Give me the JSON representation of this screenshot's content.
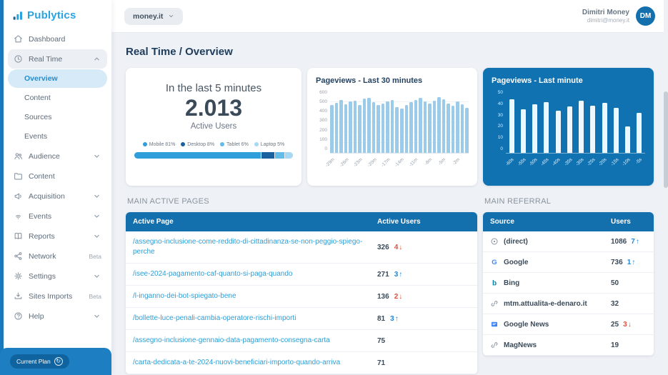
{
  "brand": {
    "name": "Publytics"
  },
  "topbar": {
    "site_selector_label": "money.it",
    "user_name": "Dimitri Money",
    "user_email": "dimitri@money.it",
    "avatar_initials": "DM"
  },
  "sidebar": {
    "items": [
      {
        "label": "Dashboard",
        "icon": "home-icon",
        "trailing": null
      },
      {
        "label": "Real Time",
        "icon": "clock-icon",
        "trailing": "chevron-up",
        "expanded": true,
        "children": [
          {
            "label": "Overview",
            "active": true
          },
          {
            "label": "Content"
          },
          {
            "label": "Sources"
          },
          {
            "label": "Events"
          }
        ]
      },
      {
        "label": "Audience",
        "icon": "users-icon",
        "trailing": "chevron-down"
      },
      {
        "label": "Content",
        "icon": "folder-icon",
        "trailing": null
      },
      {
        "label": "Acquisition",
        "icon": "megaphone-icon",
        "trailing": "chevron-down"
      },
      {
        "label": "Events",
        "icon": "signal-icon",
        "trailing": "chevron-down"
      },
      {
        "label": "Reports",
        "icon": "book-icon",
        "trailing": "chevron-down"
      },
      {
        "label": "Network",
        "icon": "share-icon",
        "trailing": "beta",
        "badge": "Beta"
      },
      {
        "label": "Settings",
        "icon": "gear-icon",
        "trailing": "chevron-down"
      },
      {
        "label": "Sites Imports",
        "icon": "import-icon",
        "trailing": "beta",
        "badge": "Beta"
      },
      {
        "label": "Help",
        "icon": "help-icon",
        "trailing": "chevron-down"
      }
    ],
    "current_plan_label": "Current Plan"
  },
  "page_title": "Real Time / Overview",
  "active_users_card": {
    "heading": "In the last 5 minutes",
    "value": "2.013",
    "subtitle": "Active Users",
    "devices": [
      {
        "label": "Mobile 81%",
        "pct": 81,
        "color": "#2f9fdc"
      },
      {
        "label": "Desktop 8%",
        "pct": 8,
        "color": "#19619f"
      },
      {
        "label": "Tablet 6%",
        "pct": 6,
        "color": "#63bce7"
      },
      {
        "label": "Laptop 5%",
        "pct": 5,
        "color": "#a6d8f3"
      }
    ]
  },
  "chart_data": [
    {
      "type": "bar",
      "title": "Pageviews - Last 30 minutes",
      "values": [
        470,
        495,
        520,
        480,
        505,
        515,
        470,
        535,
        545,
        500,
        475,
        485,
        510,
        525,
        455,
        435,
        470,
        500,
        520,
        545,
        510,
        485,
        515,
        550,
        530,
        490,
        465,
        505,
        480,
        445
      ],
      "tick_labels": [
        "-29m",
        "-26m",
        "-23m",
        "-20m",
        "-17m",
        "-14m",
        "-11m",
        "-8m",
        "-5m",
        "-2m"
      ],
      "tick_every": 3,
      "ylim": [
        0,
        600
      ],
      "yticks": [
        0,
        100,
        200,
        300,
        400,
        500,
        600
      ],
      "bar_color": "#9ccbea",
      "legend": "off",
      "grid": "on"
    },
    {
      "type": "bar",
      "title": "Pageviews - Last minute",
      "categories": [
        "-60s",
        "-55s",
        "-50s",
        "-45s",
        "-40s",
        "-35s",
        "-30s",
        "-25s",
        "-20s",
        "-15s",
        "-10s",
        "-5s"
      ],
      "values": [
        44,
        36,
        40,
        42,
        35,
        38,
        43,
        39,
        41,
        37,
        22,
        33
      ],
      "ylim": [
        0,
        50
      ],
      "yticks": [
        0,
        10,
        20,
        30,
        40,
        50
      ],
      "bar_color": "#eef7fd",
      "legend": "off",
      "grid": "off"
    }
  ],
  "main_active_pages": {
    "section_title": "MAIN ACTIVE PAGES",
    "columns": [
      "Active Page",
      "Active Users"
    ],
    "rows": [
      {
        "page": "/assegno-inclusione-come-reddito-di-cittadinanza-se-non-peggio-spiego-perche",
        "users": "326",
        "delta": "4",
        "delta_dir": "down"
      },
      {
        "page": "/isee-2024-pagamento-caf-quanto-si-paga-quando",
        "users": "271",
        "delta": "3",
        "delta_dir": "up"
      },
      {
        "page": "/l-inganno-dei-bot-spiegato-bene",
        "users": "136",
        "delta": "2",
        "delta_dir": "down"
      },
      {
        "page": "/bollette-luce-penali-cambia-operatore-rischi-importi",
        "users": "81",
        "delta": "3",
        "delta_dir": "up"
      },
      {
        "page": "/assegno-inclusione-gennaio-data-pagamento-consegna-carta",
        "users": "75",
        "delta": "",
        "delta_dir": ""
      },
      {
        "page": "/carta-dedicata-a-te-2024-nuovi-beneficiari-importo-quando-arriva",
        "users": "71",
        "delta": "",
        "delta_dir": ""
      }
    ]
  },
  "main_referral": {
    "section_title": "MAIN REFERRAL",
    "columns": [
      "Source",
      "Users"
    ],
    "rows": [
      {
        "source": "(direct)",
        "icon": "direct-icon",
        "users": "1086",
        "delta": "7",
        "delta_dir": "up"
      },
      {
        "source": "Google",
        "icon": "google-icon",
        "users": "736",
        "delta": "1",
        "delta_dir": "up"
      },
      {
        "source": "Bing",
        "icon": "bing-icon",
        "users": "50",
        "delta": "",
        "delta_dir": ""
      },
      {
        "source": "mtm.attualita-e-denaro.it",
        "icon": "link-icon",
        "users": "32",
        "delta": "",
        "delta_dir": ""
      },
      {
        "source": "Google News",
        "icon": "gnews-icon",
        "users": "25",
        "delta": "3",
        "delta_dir": "down"
      },
      {
        "source": "MagNews",
        "icon": "link-icon",
        "users": "19",
        "delta": "",
        "delta_dir": ""
      }
    ]
  },
  "colors": {
    "primary_blue": "#1470ad",
    "brand_blue": "#2aa3e2",
    "link_blue": "#2e9ed6",
    "delta_up": "#1d87d8",
    "delta_down": "#e2503c"
  }
}
